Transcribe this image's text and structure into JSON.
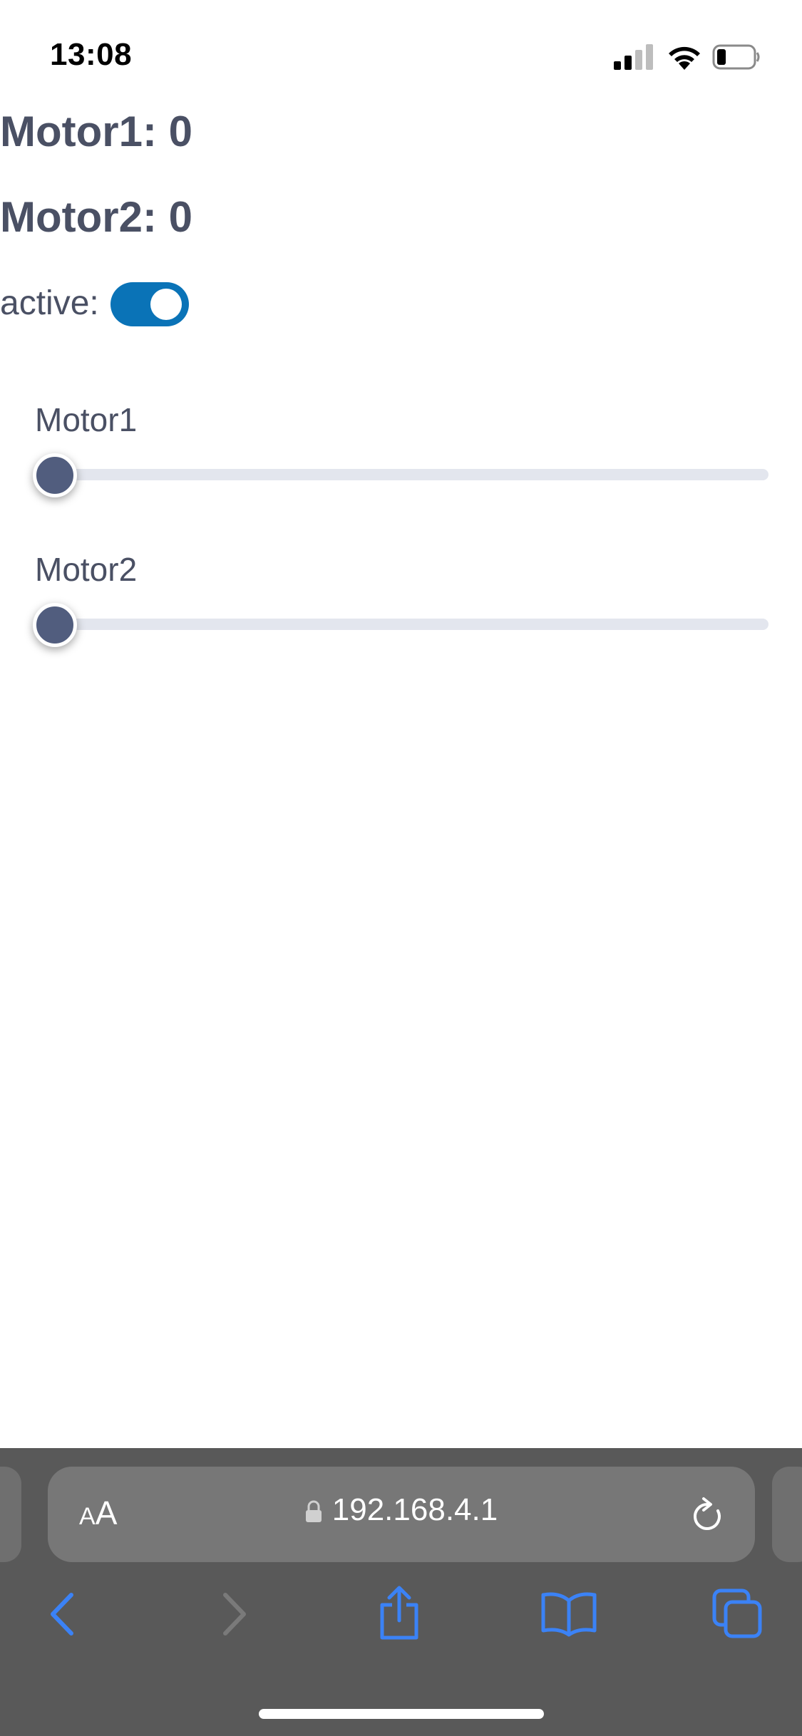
{
  "status_bar": {
    "time": "13:08",
    "icons": [
      "cellular-signal-icon",
      "wifi-icon",
      "battery-icon"
    ]
  },
  "page": {
    "motor1_heading": "Motor1: 0",
    "motor2_heading": "Motor2: 0",
    "active_label": "active:",
    "active_toggle_on": true,
    "sliders": [
      {
        "label": "Motor1",
        "value": 0
      },
      {
        "label": "Motor2",
        "value": 0
      }
    ]
  },
  "browser": {
    "text_size_button": {
      "small": "A",
      "large": "A"
    },
    "url": "192.168.4.1",
    "toolbar": [
      "back-icon",
      "forward-icon",
      "share-icon",
      "bookmarks-icon",
      "tabs-icon"
    ]
  },
  "colors": {
    "text": "#4a5064",
    "toggle_on": "#0a73b7",
    "slider_track": "#e3e6ee",
    "slider_thumb": "#515d7e",
    "browser_bar": "#595959",
    "address_bar": "#777777",
    "toolbar_icon": "#3b82f6"
  }
}
